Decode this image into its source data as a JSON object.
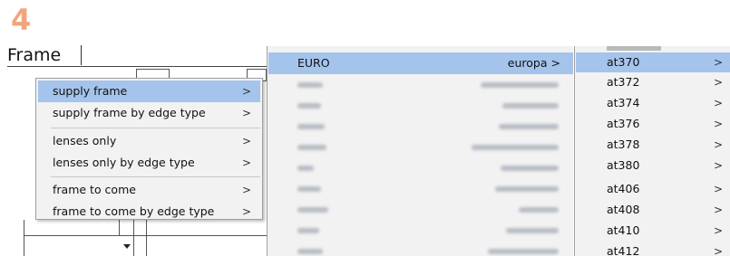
{
  "step": {
    "number": "4"
  },
  "form": {
    "frame_label": "Frame"
  },
  "menu1": {
    "items": [
      {
        "label": "supply frame",
        "arrow": ">",
        "selected": true
      },
      {
        "label": "supply frame by edge type",
        "arrow": ">"
      },
      {
        "label": "lenses only",
        "arrow": ">"
      },
      {
        "label": "lenses only by edge type",
        "arrow": ">"
      },
      {
        "label": "frame to come",
        "arrow": ">"
      },
      {
        "label": "frame to come by edge type",
        "arrow": ">"
      }
    ]
  },
  "menu2": {
    "selected": {
      "code": "EURO",
      "name": "europa",
      "arrow": ">"
    },
    "redacted_rows": 9
  },
  "menu3": {
    "items": [
      {
        "label": "at370",
        "arrow": ">",
        "selected": true
      },
      {
        "label": "at372",
        "arrow": ">"
      },
      {
        "label": "at374",
        "arrow": ">"
      },
      {
        "label": "at376",
        "arrow": ">"
      },
      {
        "label": "at378",
        "arrow": ">"
      },
      {
        "label": "at380",
        "arrow": ">"
      },
      {
        "label": "at406",
        "arrow": ">"
      },
      {
        "label": "at408",
        "arrow": ">"
      },
      {
        "label": "at410",
        "arrow": ">"
      },
      {
        "label": "at412",
        "arrow": ">"
      }
    ]
  },
  "colors": {
    "step_orange": "#f1a57a",
    "menu_background": "#f2f2f2",
    "selection_highlight": "#a5c4ec"
  }
}
